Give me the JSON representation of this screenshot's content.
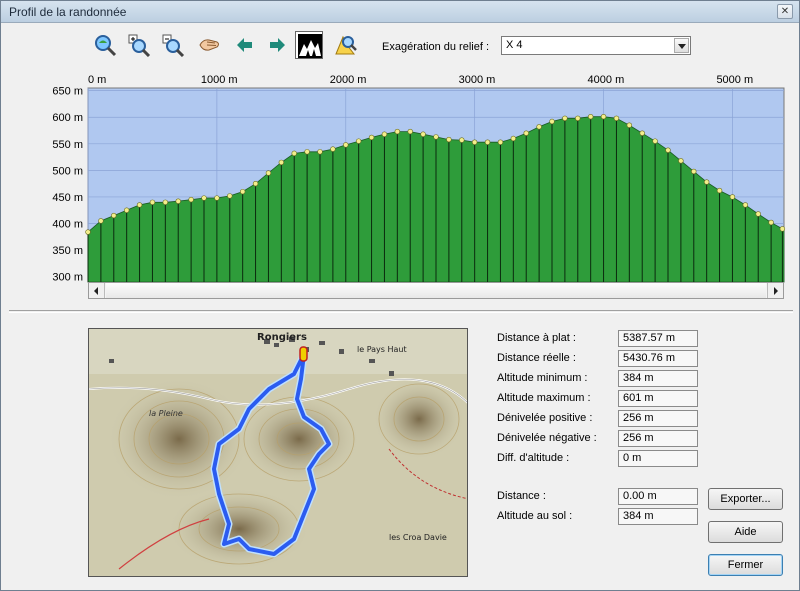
{
  "window": {
    "title": "Profil de la randonnée",
    "close_glyph": "✕"
  },
  "toolbar": {
    "items": [
      {
        "name": "zoom-fit-icon"
      },
      {
        "name": "zoom-in-icon"
      },
      {
        "name": "zoom-out-icon"
      },
      {
        "name": "pan-hand-icon"
      },
      {
        "name": "arrow-left-icon"
      },
      {
        "name": "arrow-right-icon"
      },
      {
        "name": "relief-view-icon",
        "active": true
      },
      {
        "name": "map-view-icon"
      }
    ],
    "relief_label": "Exagération du relief :",
    "relief_value": "X 4"
  },
  "chart_data": {
    "type": "area",
    "xlabel": "",
    "ylabel": "",
    "x_ticks": [
      "0 m",
      "1000 m",
      "2000 m",
      "3000 m",
      "4000 m",
      "5000 m"
    ],
    "y_ticks": [
      "650 m",
      "600 m",
      "550 m",
      "500 m",
      "450 m",
      "400 m",
      "350 m",
      "300 m"
    ],
    "xlim": [
      0,
      5387.57
    ],
    "ylim": [
      290,
      655
    ],
    "grid": true,
    "colors": {
      "fill": "#2e9c3a",
      "background": "#b0c8f0",
      "point": "#f2ef8c",
      "grid": "#8aa3d6"
    },
    "x": [
      0,
      100,
      200,
      300,
      400,
      500,
      600,
      700,
      800,
      900,
      1000,
      1100,
      1200,
      1300,
      1400,
      1500,
      1600,
      1700,
      1800,
      1900,
      2000,
      2100,
      2200,
      2300,
      2400,
      2500,
      2600,
      2700,
      2800,
      2900,
      3000,
      3100,
      3200,
      3300,
      3400,
      3500,
      3600,
      3700,
      3800,
      3900,
      4000,
      4100,
      4200,
      4300,
      4400,
      4500,
      4600,
      4700,
      4800,
      4900,
      5000,
      5100,
      5200,
      5300,
      5387.57
    ],
    "values": [
      384,
      405,
      415,
      425,
      435,
      440,
      440,
      442,
      445,
      448,
      448,
      452,
      460,
      475,
      495,
      515,
      532,
      535,
      535,
      540,
      548,
      555,
      562,
      568,
      573,
      573,
      568,
      563,
      558,
      557,
      553,
      553,
      553,
      560,
      570,
      582,
      592,
      598,
      598,
      601,
      601,
      598,
      585,
      570,
      555,
      538,
      518,
      498,
      478,
      462,
      450,
      435,
      418,
      402,
      390
    ]
  },
  "stats": [
    {
      "label": "Distance à plat :",
      "value": "5387.57 m"
    },
    {
      "label": "Distance réelle :",
      "value": "5430.76 m"
    },
    {
      "label": "Altitude minimum :",
      "value": "384 m"
    },
    {
      "label": "Altitude maximum :",
      "value": "601 m"
    },
    {
      "label": "Dénivelée positive :",
      "value": "256 m"
    },
    {
      "label": "Dénivelée négative :",
      "value": "256 m"
    },
    {
      "label": "Diff. d'altitude :",
      "value": "0 m"
    }
  ],
  "cursor": [
    {
      "label": "Distance :",
      "value": "0.00 m"
    },
    {
      "label": "Altitude au sol :",
      "value": "384 m"
    }
  ],
  "buttons": {
    "export": "Exporter...",
    "help": "Aide",
    "close": "Fermer"
  },
  "map": {
    "place_labels": [
      "Rongiers",
      "le Pays Haut",
      "la Pleine",
      "les Croa Davie"
    ],
    "colors": {
      "route": "#2b5cf0",
      "route_outline": "#bfe0ff",
      "relief": "#c9c5a8",
      "start_marker": "#f0d000"
    }
  }
}
